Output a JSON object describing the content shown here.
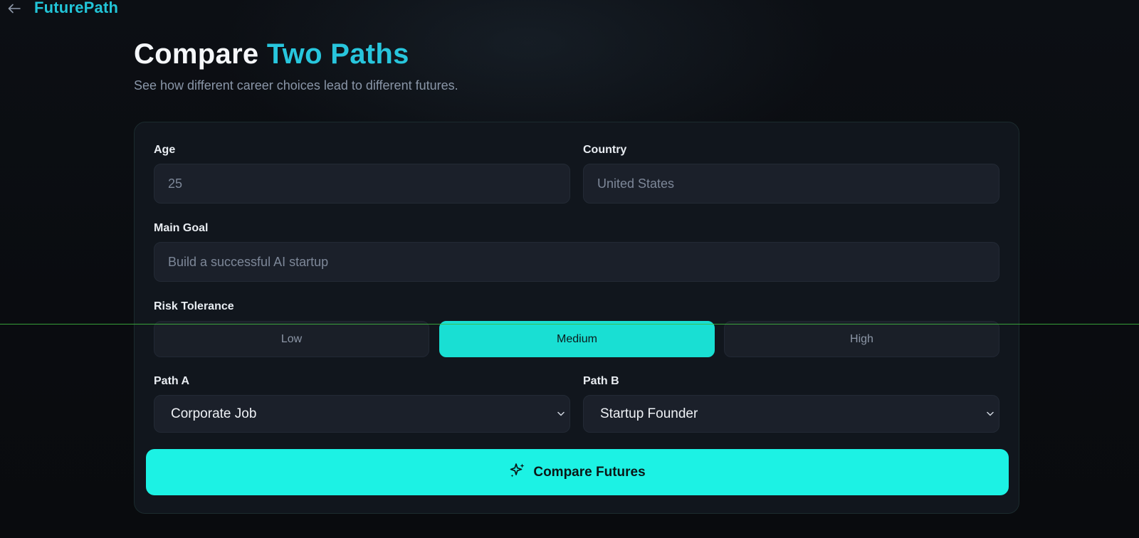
{
  "app": {
    "brand": "FuturePath"
  },
  "header": {
    "title_main": "Compare ",
    "title_accent": "Two Paths",
    "subtitle": "See how different career choices lead to different futures."
  },
  "form": {
    "age": {
      "label": "Age",
      "placeholder": "25"
    },
    "country": {
      "label": "Country",
      "placeholder": "United States"
    },
    "goal": {
      "label": "Main Goal",
      "placeholder": "Build a successful AI startup"
    },
    "risk": {
      "label": "Risk Tolerance",
      "options": [
        "Low",
        "Medium",
        "High"
      ],
      "selected": "Medium"
    },
    "path_a": {
      "label": "Path A",
      "value": "Corporate Job"
    },
    "path_b": {
      "label": "Path B",
      "value": "Startup Founder"
    },
    "submit_label": "Compare Futures"
  },
  "icons": {
    "back": "arrow-left-icon",
    "submit": "sparkles-icon",
    "select": "chevron-down-icon"
  },
  "colors": {
    "accent": "#28c6dd",
    "primary_button": "#1cf2e4",
    "active_option": "#19dfd3",
    "background": "#0a0c10",
    "card": "#11161d"
  }
}
